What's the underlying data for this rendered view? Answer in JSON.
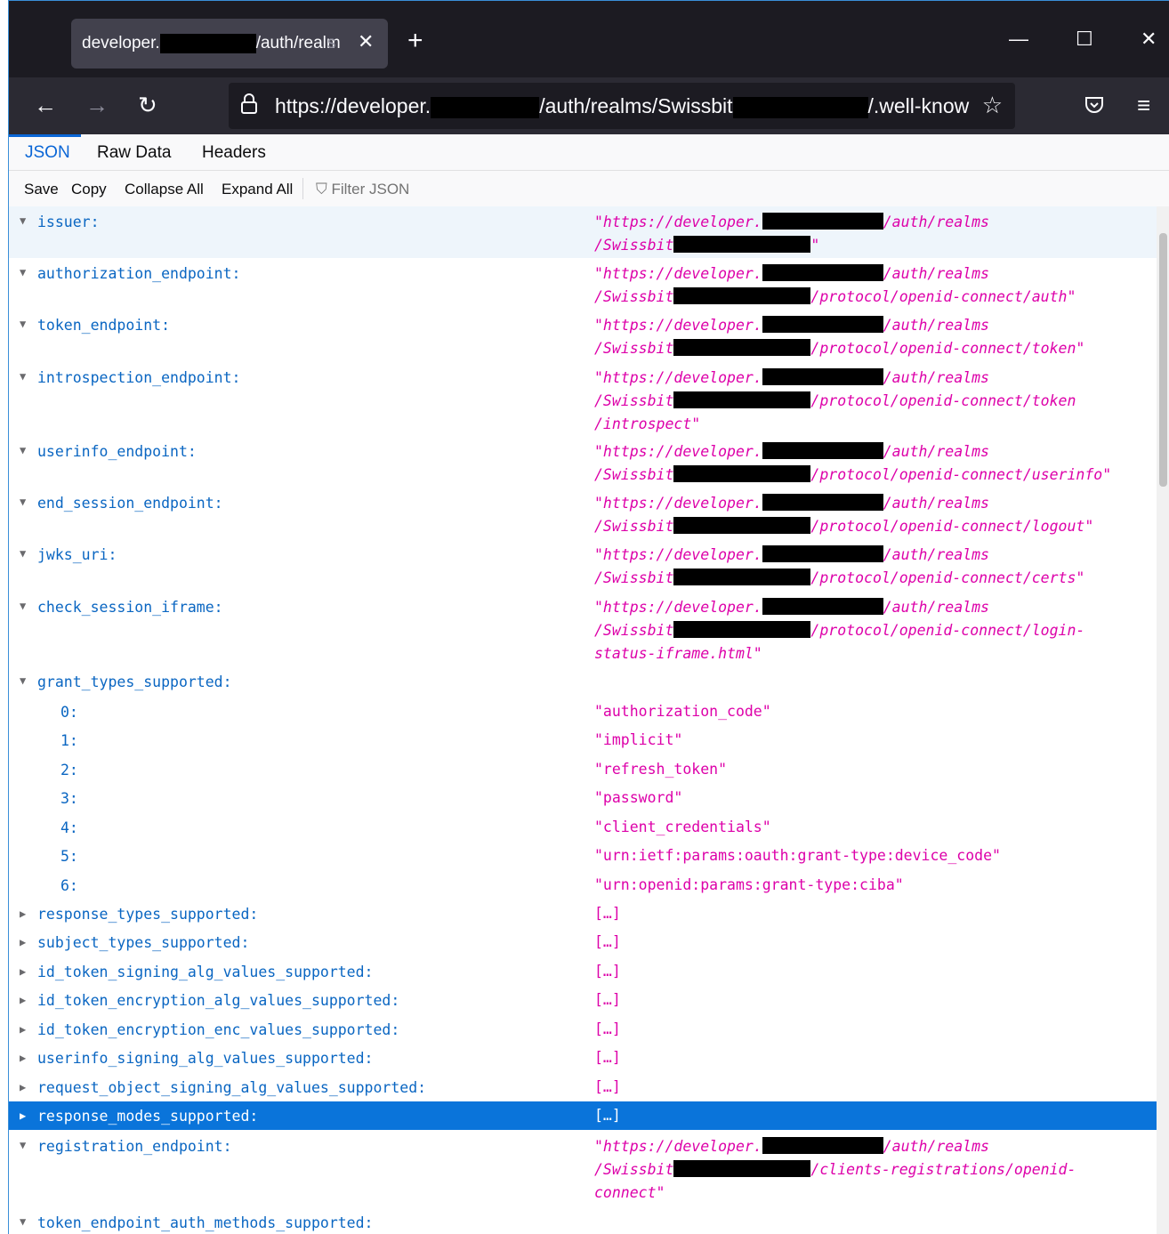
{
  "browser": {
    "tab_title_start": "developer.",
    "tab_title_end": "/auth/realm",
    "tab_title_fade": "s",
    "tab_close": "✕",
    "new_tab": "+",
    "url_part1": "https://developer.",
    "url_part2": "/auth/realms/Swissbit",
    "url_part3": "/.well-know",
    "window_minimize": "—",
    "window_maximize": "☐",
    "window_close": "✕"
  },
  "viewer": {
    "tabs": [
      "JSON",
      "Raw Data",
      "Headers"
    ],
    "toolbar": [
      "Save",
      "Copy",
      "Collapse All",
      "Expand All"
    ],
    "filter_placeholder": "Filter JSON"
  },
  "json": {
    "issuer": {
      "key": "issuer:",
      "l1a": "\"https://developer.",
      "l1b": "/auth/realms",
      "l2a": "/Swissbit",
      "l2b": "\""
    },
    "authorization_endpoint": {
      "key": "authorization_endpoint:",
      "l1a": "\"https://developer.",
      "l1b": "/auth/realms",
      "l2a": "/Swissbit",
      "l2b": "/protocol/openid-connect/auth\""
    },
    "token_endpoint": {
      "key": "token_endpoint:",
      "l1a": "\"https://developer.",
      "l1b": "/auth/realms",
      "l2a": "/Swissbit",
      "l2b": "/protocol/openid-connect/token\""
    },
    "introspection_endpoint": {
      "key": "introspection_endpoint:",
      "l1a": "\"https://developer.",
      "l1b": "/auth/realms",
      "l2a": "/Swissbit",
      "l2b": "/protocol/openid-connect/token",
      "l3": "/introspect\""
    },
    "userinfo_endpoint": {
      "key": "userinfo_endpoint:",
      "l1a": "\"https://developer.",
      "l1b": "/auth/realms",
      "l2a": "/Swissbit",
      "l2b": "/protocol/openid-connect/userinfo\""
    },
    "end_session_endpoint": {
      "key": "end_session_endpoint:",
      "l1a": "\"https://developer.",
      "l1b": "/auth/realms",
      "l2a": "/Swissbit",
      "l2b": "/protocol/openid-connect/logout\""
    },
    "jwks_uri": {
      "key": "jwks_uri:",
      "l1a": "\"https://developer.",
      "l1b": "/auth/realms",
      "l2a": "/Swissbit",
      "l2b": "/protocol/openid-connect/certs\""
    },
    "check_session_iframe": {
      "key": "check_session_iframe:",
      "l1a": "\"https://developer.",
      "l1b": "/auth/realms",
      "l2a": "/Swissbit",
      "l2b": "/protocol/openid-connect/login-",
      "l3": "status-iframe.html\""
    },
    "grant_types_supported": {
      "key": "grant_types_supported:",
      "items": [
        {
          "i": "0:",
          "v": "\"authorization_code\""
        },
        {
          "i": "1:",
          "v": "\"implicit\""
        },
        {
          "i": "2:",
          "v": "\"refresh_token\""
        },
        {
          "i": "3:",
          "v": "\"password\""
        },
        {
          "i": "4:",
          "v": "\"client_credentials\""
        },
        {
          "i": "5:",
          "v": "\"urn:ietf:params:oauth:grant-type:device_code\""
        },
        {
          "i": "6:",
          "v": "\"urn:openid:params:grant-type:ciba\""
        }
      ]
    },
    "collapsed": [
      {
        "key": "response_types_supported:",
        "v": "[…]"
      },
      {
        "key": "subject_types_supported:",
        "v": "[…]"
      },
      {
        "key": "id_token_signing_alg_values_supported:",
        "v": "[…]"
      },
      {
        "key": "id_token_encryption_alg_values_supported:",
        "v": "[…]"
      },
      {
        "key": "id_token_encryption_enc_values_supported:",
        "v": "[…]"
      },
      {
        "key": "userinfo_signing_alg_values_supported:",
        "v": "[…]"
      },
      {
        "key": "request_object_signing_alg_values_supported:",
        "v": "[…]"
      },
      {
        "key": "response_modes_supported:",
        "v": "[…]"
      }
    ],
    "registration_endpoint": {
      "key": "registration_endpoint:",
      "l1a": "\"https://developer.",
      "l1b": "/auth/realms",
      "l2a": "/Swissbit",
      "l2b": "/clients-registrations/openid-",
      "l3": "connect\""
    },
    "token_endpoint_auth_methods_supported": {
      "key": "token_endpoint_auth_methods_supported:"
    }
  }
}
